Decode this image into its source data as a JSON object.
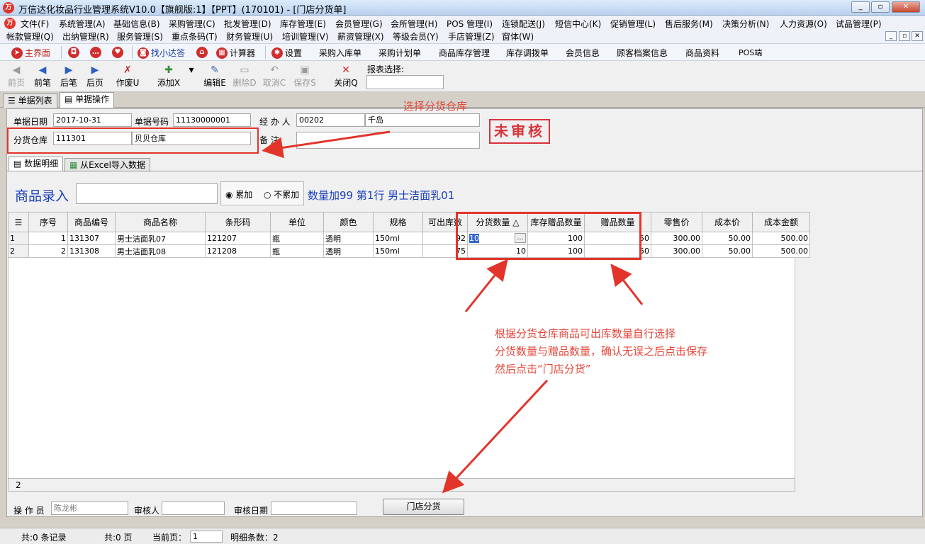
{
  "window": {
    "title": "万信达化妆品行业管理系统V10.0【旗舰版:1】【PPT】(170101) - [门店分货单]",
    "logo": "万信达",
    "min": "_",
    "restore": "▫",
    "close": "✕"
  },
  "menu": {
    "row1": [
      "文件(F)",
      "系统管理(A)",
      "基础信息(B)",
      "采购管理(C)",
      "批发管理(D)",
      "库存管理(E)",
      "会员管理(G)",
      "会所管理(H)",
      "POS 管理(I)",
      "连锁配送(J)",
      "短信中心(K)",
      "促销管理(L)",
      "售后服务(M)",
      "决策分析(N)",
      "人力资源(O)",
      "试品管理(P)"
    ],
    "row2": [
      "帐款管理(Q)",
      "出纳管理(R)",
      "服务管理(S)",
      "重点条码(T)",
      "财务管理(U)",
      "培训管理(V)",
      "薪资管理(X)",
      "等级会员(Y)",
      "手店管理(Z)",
      "窗体(W)"
    ]
  },
  "quickbar": {
    "home": "主界面",
    "assistant": "找小达答",
    "calculator": "计算器",
    "settings": "设置",
    "links": [
      "采购入库单",
      "采购计划单",
      "商品库存管理",
      "库存调拨单",
      "会员信息",
      "顾客档案信息",
      "商品资料",
      "POS端"
    ]
  },
  "toolbar": {
    "prev_page": "前页",
    "prev": "前笔",
    "next": "后笔",
    "next_page": "后页",
    "void": "作废U",
    "add": "添加X",
    "edit": "编辑E",
    "delete": "删除D",
    "cancel": "取消C",
    "save": "保存S",
    "close": "关闭Q",
    "report_select": "报表选择:"
  },
  "tabs": {
    "list": "单据列表",
    "operation": "单据操作"
  },
  "form": {
    "date_label": "单据日期",
    "date": "2017-10-31",
    "no_label": "单据号码",
    "no": "11130000001",
    "handler_label": "经 办 人",
    "handler_code": "00202",
    "handler_name": "千岛",
    "warehouse_label": "分货仓库",
    "warehouse_code": "111301",
    "warehouse_name": "贝贝仓库",
    "remark_label": "备    注",
    "remark": "",
    "status": "未审核"
  },
  "subtabs": {
    "detail": "数据明细",
    "excel": "从Excel导入数据"
  },
  "entry": {
    "label": "商品录入",
    "value": "",
    "acc": "累加",
    "noacc": "不累加",
    "info": "数量加99 第1行   男士洁面乳01"
  },
  "grid": {
    "headers": [
      "序号",
      "商品编号",
      "商品名称",
      "条形码",
      "单位",
      "颜色",
      "规格",
      "可出库数",
      "分货数量",
      "库存赠品数量",
      "赠品数量",
      "零售价",
      "成本价",
      "成本金额"
    ],
    "rows": [
      [
        "1",
        "131307",
        "男士洁面乳07",
        "121207",
        "瓶",
        "透明",
        "150ml",
        "92",
        "10",
        "100",
        "50",
        "300.00",
        "50.00",
        "500.00"
      ],
      [
        "2",
        "131308",
        "男士洁面乳08",
        "121208",
        "瓶",
        "透明",
        "150ml",
        "75",
        "10",
        "100",
        "50",
        "300.00",
        "50.00",
        "500.00"
      ]
    ],
    "footer_count": "2"
  },
  "bottom": {
    "operator_label": "操 作 员",
    "operator": "陈龙彬",
    "auditor_label": "审核人",
    "auditor": "",
    "audit_date_label": "审核日期",
    "audit_date": "",
    "store_dist_button": "门店分货"
  },
  "annotations": {
    "warehouse_tip": "选择分货仓库",
    "instruction": [
      "根据分货仓库商品可出库数量自行选择",
      "分货数量与赠品数量，确认无误之后点击保存",
      "然后点击“门店分货”"
    ]
  },
  "status": {
    "records": "共:0 条记录",
    "pages": "共:0 页",
    "current_page_label": "当前页：",
    "current_page": "1",
    "detail_count": "明细条数：2"
  }
}
